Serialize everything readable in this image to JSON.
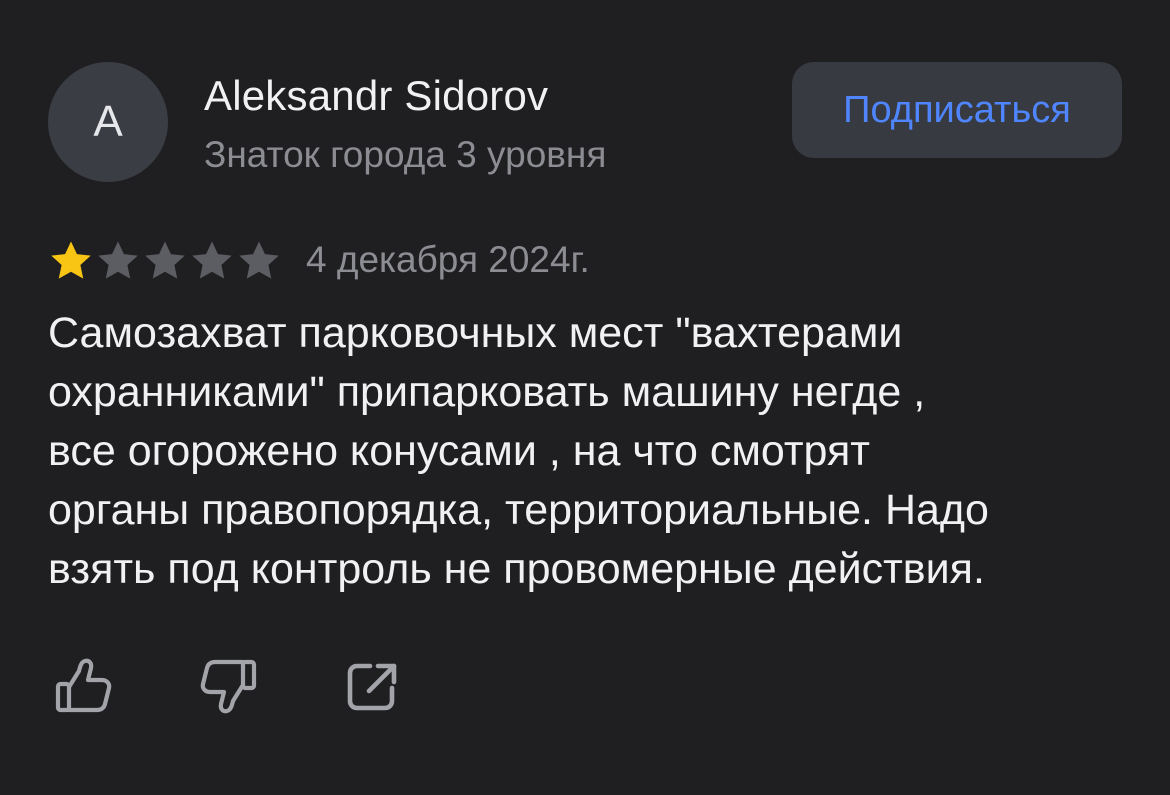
{
  "author": {
    "avatar_letter": "A",
    "name": "Aleksandr Sidorov",
    "level": "Знаток города 3 уровня"
  },
  "subscribe_button": {
    "label": "Подписаться"
  },
  "review": {
    "rating": 1,
    "max_rating": 5,
    "date": "4 декабря 2024г.",
    "text_lines": [
      "Самозахват парковочных мест \"вахтерами",
      "охранниками\" припарковать машину негде ,",
      " все огорожено конусами , на что смотрят",
      "органы правопорядка, территориальные. Надо",
      "взять под контроль не провомерные действия."
    ]
  },
  "actions": {
    "like_icon": "thumbs-up-icon",
    "dislike_icon": "thumbs-down-icon",
    "share_icon": "share-icon"
  },
  "colors": {
    "background": "#1f1f22",
    "accent": "#4f86ff",
    "star_filled": "#f8c514",
    "star_empty": "#5c5d62",
    "muted_text": "#8c8d93",
    "button_bg": "#383a41"
  }
}
